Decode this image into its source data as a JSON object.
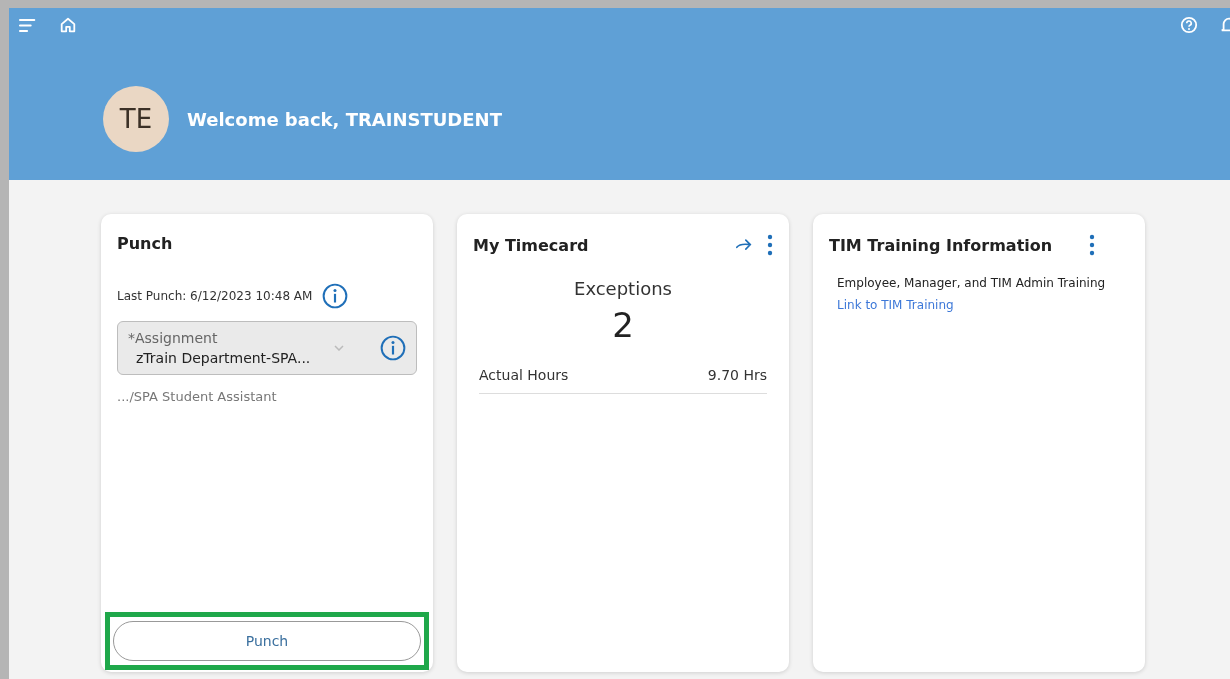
{
  "header": {
    "avatar_initials": "TE",
    "welcome": "Welcome back, TRAINSTUDENT"
  },
  "punch_card": {
    "title": "Punch",
    "last_punch": "Last Punch: 6/12/2023 10:48 AM",
    "assignment": {
      "label": "*Assignment",
      "value": "zTrain Department-SPA..."
    },
    "assignment_detail": ".../SPA Student Assistant",
    "button": {
      "label": "Punch",
      "highlighted": true
    }
  },
  "timecard_card": {
    "title": "My Timecard",
    "exceptions_label": "Exceptions",
    "exceptions_count": "2",
    "rows": [
      {
        "label": "Actual Hours",
        "value": "9.70 Hrs"
      }
    ]
  },
  "training_card": {
    "title": "TIM Training Information",
    "description": "Employee, Manager, and TIM Admin Training",
    "link": "Link to TIM Training"
  }
}
